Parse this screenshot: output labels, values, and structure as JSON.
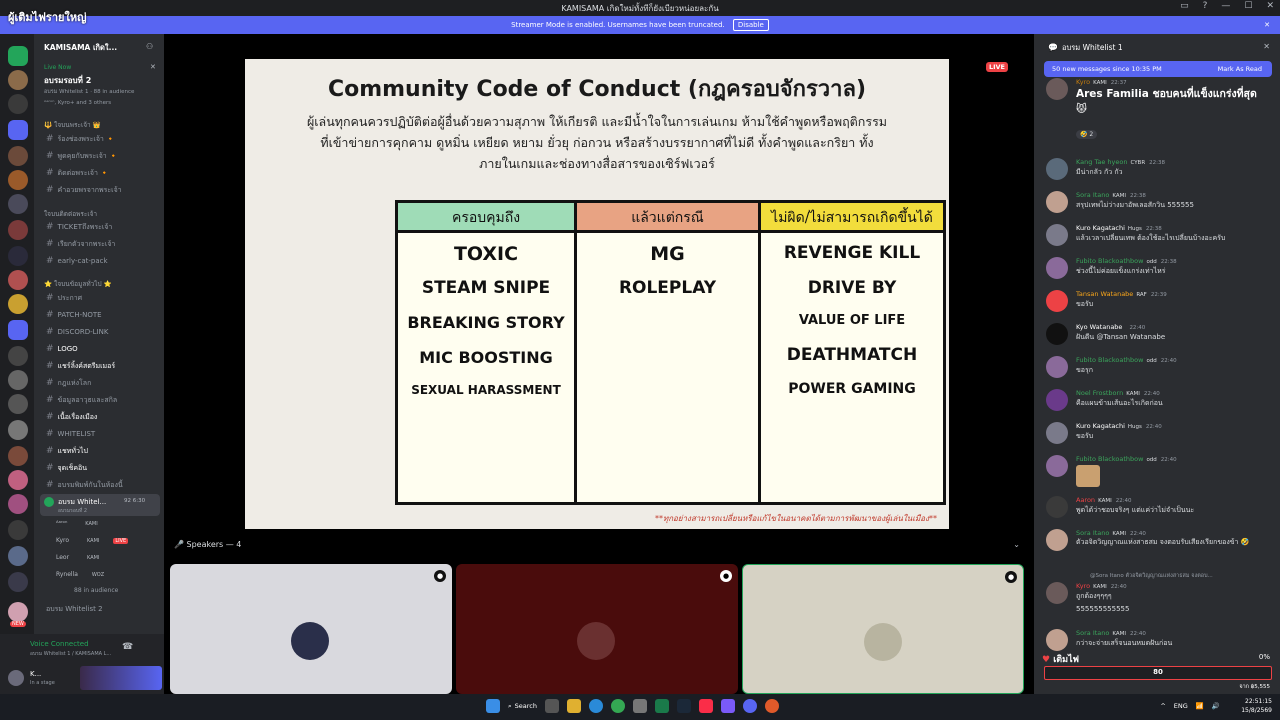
{
  "window": {
    "title": "KAMISAMA เกิดใหม่ทั้งทีก็ยังเบียวหน่อยละกัน",
    "overlay_title": "ผู้เติมไฟรายใหญ่",
    "controls": [
      "▭",
      "?",
      "—",
      "☐",
      "✕"
    ]
  },
  "banner": {
    "text": "Streamer Mode is enabled. Usernames have been truncated.",
    "button": "Disable",
    "close": "✕"
  },
  "rail": {
    "badges": [
      "32",
      "570",
      "43",
      "80",
      "54",
      "160",
      "36",
      "41",
      "24",
      "NEW"
    ]
  },
  "server": {
    "name": "KAMISAMA เกิดใ...",
    "event_live": "Live Now",
    "event_title": "อบรมรอบที่ 2",
    "event_meta": "อบรม Whitelist 1 · 88 in audience",
    "event_meta2": "ᴬᵃʳᵒⁿ, Kyro+ and 3 others",
    "categories": [
      "🔱 ใจบนพระเจ้า 👑",
      "ใจบนติดต่อพระเจ้า",
      "⭐ ใจบนข้อมูลทั่วไป ⭐"
    ],
    "channels": [
      "ร้องช่องพระเจ้า 🔸",
      "พูดคุยกับพระเจ้า 🔸",
      "ติดต่อพระเจ้า 🔸",
      "คำอวยพรจากพระเจ้า",
      "TICKETถึงพระเจ้า",
      "เรียกตัวจากพระเจ้า",
      "early-cat-pack",
      "ประกาศ",
      "PATCH-NOTE",
      "DISCORD-LINK",
      "LOGO",
      "แชร์ลิ้งค์สตรีมเมอร์",
      "กฎแห่งโลก",
      "ข้อมูลอาวุธและสกิล",
      "เนื้อเรื่องเมือง",
      "WHITELIST",
      "แชททั่วไป",
      "จุดเช็คอิน",
      "อบรมพิมพ์กันในห้องนี้",
      "อบรม Whitel...",
      "อบรมรอบที่ 2",
      "อบรม Whitelist 2"
    ],
    "stage_users": [
      {
        "name": "ᴬᵃʳᵒⁿ",
        "tag": "KAMI"
      },
      {
        "name": "Kyro",
        "tag": "KAMI",
        "live": "LIVE"
      },
      {
        "name": "Leor",
        "tag": "KAMI"
      },
      {
        "name": "Rynella",
        "tag": "WOZ"
      }
    ],
    "stage_counts": "92  6:30",
    "audience": "88 in audience"
  },
  "voice": {
    "status": "Voice Connected",
    "channel": "อบรม Whitelist 1 / KAMISAMA L...",
    "user": "K...",
    "user_status": "In a stage"
  },
  "slide": {
    "title": "Community Code of Conduct (กฎครอบจักรวาล)",
    "para": "ผู้เล่นทุกคนควรปฏิบัติต่อผู้อื่นด้วยความสุภาพ ให้เกียรติ และมีน้ำใจในการเล่นเกม ห้ามใช้คำพูดหรือพฤติกรรมที่เข้าข่ายการคุกคาม ดูหมิ่น เหยียด หยาม ยั่วยุ ก่อกวน หรือสร้างบรรยากาศที่ไม่ดี ทั้งคำพูดและกริยา ทั้งภายในเกมและช่องทางสื่อสารของเซิร์ฟเวอร์",
    "columns": [
      {
        "header": "ครอบคุมถึง",
        "color": "#9fdcb7",
        "items": [
          "TOXIC",
          "STEAM SNIPE",
          "BREAKING STORY",
          "MIC BOOSTING",
          "SEXUAL HARASSMENT"
        ]
      },
      {
        "header": "แล้วแต่กรณี",
        "color": "#e8a383",
        "items": [
          "MG",
          "ROLEPLAY"
        ]
      },
      {
        "header": "ไม่ผิด/ไม่สามารถเกิดขึ้นได้",
        "color": "#f2dd3c",
        "items": [
          "REVENGE KILL",
          "DRIVE BY",
          "VALUE OF LIFE",
          "DEATHMATCH",
          "POWER GAMING"
        ]
      }
    ],
    "note": "**ทุกอย่างสามารถเปลี่ยนหรือแก้ไขในอนาคตได้ตามการพัฒนาของผู้เล่นในเมือง**",
    "live": "LIVE"
  },
  "speakers": {
    "label": "Speakers — 4"
  },
  "chat": {
    "header": "อบรม Whitelist 1",
    "new_messages": "50 new messages since 10:35 PM",
    "mark_read": "Mark As Read",
    "messages": [
      {
        "name": "Kyro",
        "tag": "KAMI",
        "time": "22:37",
        "text": "Ares Familia ชอบคนที่แข็งแกร่งที่สุด 😾",
        "color": "#c27c0e",
        "big": true,
        "reactions": "🤣 2"
      },
      {
        "name": "Kang Tae hyeon",
        "tag": "CYBR",
        "time": "22:38",
        "text": "มีน่ากลัว กัว กัว",
        "color": "#3ba55c"
      },
      {
        "name": "Sora Itano",
        "tag": "KAMI",
        "time": "22:38",
        "text": "สรุปเทพไม่ว่างมาอัพเลอสักวิน 555555",
        "color": "#3ba55c"
      },
      {
        "name": "Kuro Kagatachi",
        "tag": "Hugs",
        "time": "22:38",
        "text": "แล้วเวลาเปลี่ยนเทพ ต้องใช้อะไรเปลี่ยนบ้างอะครับ",
        "color": "#ffffff"
      },
      {
        "name": "Fubito Blackoathbow",
        "tag": "odd",
        "time": "22:38",
        "text": "ช่วงนี้ไม่ค่อยแข็งแกร่งเท่าไหร่",
        "color": "#3ba55c"
      },
      {
        "name": "Tansan Watanabe",
        "tag": "RAF",
        "time": "22:39",
        "text": "ขอรับ",
        "color": "#faa61a"
      },
      {
        "name": "Kyo Watanabe",
        "tag": "",
        "time": "22:40",
        "text": "ฝันดีน @Tansan Watanabe",
        "color": "#ffffff"
      },
      {
        "name": "Fubito Blackoathbow",
        "tag": "odd",
        "time": "22:40",
        "text": "ขอรุก",
        "color": "#3ba55c"
      },
      {
        "name": "Noel Frostborn",
        "tag": "KAMI",
        "time": "22:40",
        "text": "คือแผนข้ามเส้นอะไรเกิดก่อน",
        "color": "#3ba55c"
      },
      {
        "name": "Kuro Kagatachi",
        "tag": "Hugs",
        "time": "22:40",
        "text": "ขอรับ",
        "color": "#ffffff"
      },
      {
        "name": "Fubito Blackoathbow",
        "tag": "odd",
        "time": "22:40",
        "text": "",
        "color": "#3ba55c"
      },
      {
        "name": "Aaron",
        "tag": "KAMI",
        "time": "22:40",
        "text": "พูดได้ว่าชอบจริงๆ แต่แค่ว่าไม่จำเป็นนะ",
        "color": "#ed4245"
      },
      {
        "name": "Sora Itano",
        "tag": "KAMI",
        "time": "22:40",
        "text": "ตัวอจิตวิญญาณแห่งสาธสม จงตอบรับเสียงเรียกของข้า 🤣",
        "color": "#3ba55c"
      },
      {
        "name": "Kyro",
        "tag": "KAMI",
        "time": "22:40",
        "text": "ถูกต้องๆๆๆๆ",
        "color": "#c27c0e"
      },
      {
        "name": "",
        "tag": "",
        "time": "",
        "text": "555555555555",
        "color": "#ffffff"
      },
      {
        "name": "Sora Itano",
        "tag": "KAMI",
        "time": "22:40",
        "text": "กว่าจะจ่ายเสร็จนอนหมดฝันก่อน",
        "color": "#3ba55c"
      }
    ],
    "reply_preview": "@Sora Itano  ตัวอจิตวิญญาณแห่งสาธสม จงตอบ...",
    "goal_title": "เติมไฟ",
    "goal_percent": "0%",
    "goal_value": "80",
    "goal_footer": "จาก ฿5,555"
  },
  "taskbar": {
    "search": "Search",
    "lang": "ENG",
    "time": "22:51:15",
    "date": "15/8/2569"
  },
  "colors": {
    "discord_blurple": "#5865f2",
    "live_red": "#ed4245"
  }
}
